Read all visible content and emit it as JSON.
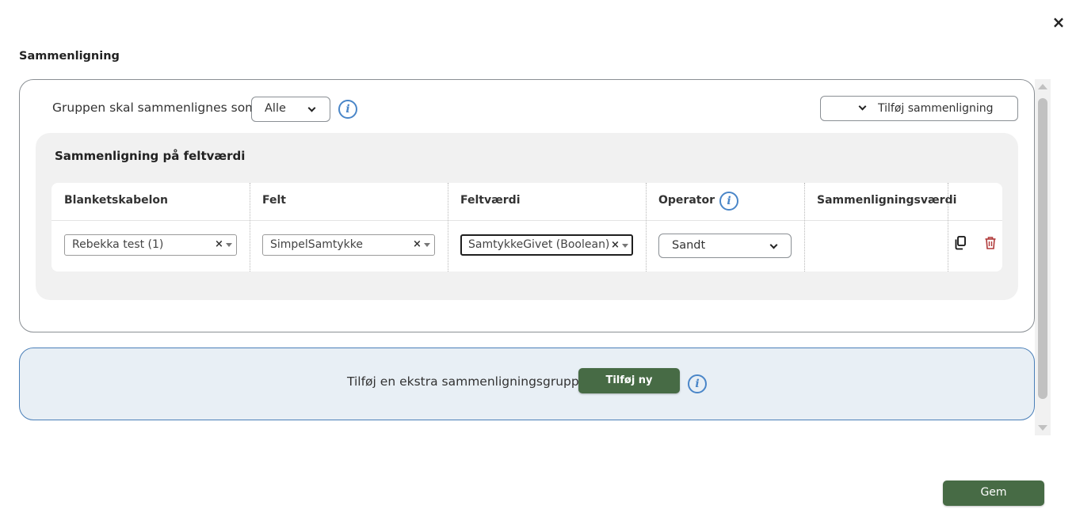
{
  "dialog": {
    "title": "Sammenligning",
    "close_label": "×"
  },
  "group": {
    "label": "Gruppen skal sammenlignes som:",
    "match_select_value": "Alle",
    "add_comparison_label": "Tilføj sammenligning",
    "info_glyph": "i"
  },
  "field_comparison": {
    "title": "Sammenligning på feltværdi",
    "columns": [
      "Blanketskabelon",
      "Felt",
      "Feltværdi",
      "Operator",
      "Sammenligningsværdi"
    ],
    "row": {
      "template": "Rebekka test (1)",
      "field": "SimpelSamtykke",
      "field_value": "SamtykkeGivet (Boolean)",
      "operator": "Sandt",
      "comparison_value": "",
      "clear_glyph": "×"
    }
  },
  "extra_group": {
    "label": "Tilføj en ekstra sammenligningsgruppe",
    "add_new_label": "Tilføj ny"
  },
  "footer": {
    "save_label": "Gem"
  },
  "icons": {
    "close": "close-icon",
    "info": "info-icon",
    "chevron": "chevron-down-icon",
    "copy": "copy-icon",
    "delete": "trash-icon"
  },
  "colors": {
    "primary_green": "#476b45",
    "info_blue": "#4a86c8",
    "delete_red": "#b03a3a",
    "panel_grey": "#f1f1f1",
    "extra_group_bg": "#e8eff5"
  }
}
